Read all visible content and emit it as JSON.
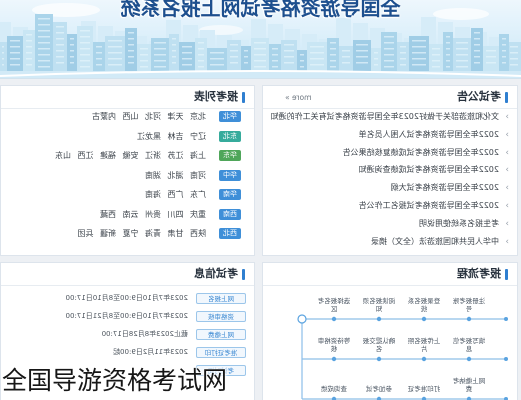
{
  "site": {
    "title": "全国导游资格考试网上报名系统"
  },
  "colors": {
    "accent": "#2f7fd0",
    "page_background": "#edf0f4",
    "title": "#1d4f8e",
    "flow_line": "#8dbfe8"
  },
  "icons": {
    "notice_bullet": "chevron-right-icon",
    "panel_header_marker": "header-bar-icon"
  },
  "notices": {
    "title": "考试公告",
    "more": "more »",
    "items": [
      "文化和旅游部关于做好2023年全国导游资格考试有关工作的通知",
      "2022年全国导游资格考试入围人员名单",
      "2022年全国导游资格考试成绩复核结果公告",
      "2022年全国导游资格考试成绩查询通知",
      "2022年全国导游资格考试大纲",
      "2022年全国导游资格考试报名工作公告",
      "考生报名系统使用说明",
      "中华人民共和国旅游法（全文）摘录"
    ]
  },
  "registration_list": {
    "title": "报考列表",
    "regions": [
      {
        "name": "华北",
        "color": "#3f8fd8",
        "provinces": [
          "北京",
          "天津",
          "河北",
          "山西",
          "内蒙古"
        ]
      },
      {
        "name": "东北",
        "color": "#36ab9c",
        "provinces": [
          "辽宁",
          "吉林",
          "黑龙江"
        ]
      },
      {
        "name": "华东",
        "color": "#4fa65a",
        "provinces": [
          "上海",
          "江苏",
          "浙江",
          "安徽",
          "福建",
          "江西",
          "山东"
        ]
      },
      {
        "name": "华中",
        "color": "#3f8fd8",
        "provinces": [
          "河南",
          "湖北",
          "湖南"
        ]
      },
      {
        "name": "华南",
        "color": "#3f8fd8",
        "provinces": [
          "广东",
          "广西",
          "海南"
        ]
      },
      {
        "name": "西南",
        "color": "#3f8fd8",
        "provinces": [
          "重庆",
          "四川",
          "贵州",
          "云南",
          "西藏"
        ]
      },
      {
        "name": "西北",
        "color": "#3f8fd8",
        "provinces": [
          "陕西",
          "甘肃",
          "青海",
          "宁夏",
          "新疆",
          "兵团"
        ]
      }
    ]
  },
  "process": {
    "title": "报考流程",
    "rows": [
      [
        "注册报考账号",
        "登录报名系统",
        "阅读报名须知",
        "选择报名考区"
      ],
      [
        "填写报考信息",
        "上传报名照片",
        "确认提交报名",
        "等待资格审核"
      ],
      [
        "网上缴纳考费",
        "打印准考证",
        "参加考试",
        "查询成绩"
      ]
    ]
  },
  "exam_info": {
    "title": "考试信息",
    "rows": [
      {
        "label": "网上报名",
        "value": "2023年7月10日9:00至8月10日17:00"
      },
      {
        "label": "资格审核",
        "value": "2023年7月10日9:00至8月21日17:00"
      },
      {
        "label": "网上缴费",
        "value": "截止2023年8月28日17:00"
      },
      {
        "label": "准考证打印",
        "value": "2023年11月2日9:00起"
      },
      {
        "label": "考试时间"
      }
    ]
  },
  "caption": "全国导游资格考试网"
}
